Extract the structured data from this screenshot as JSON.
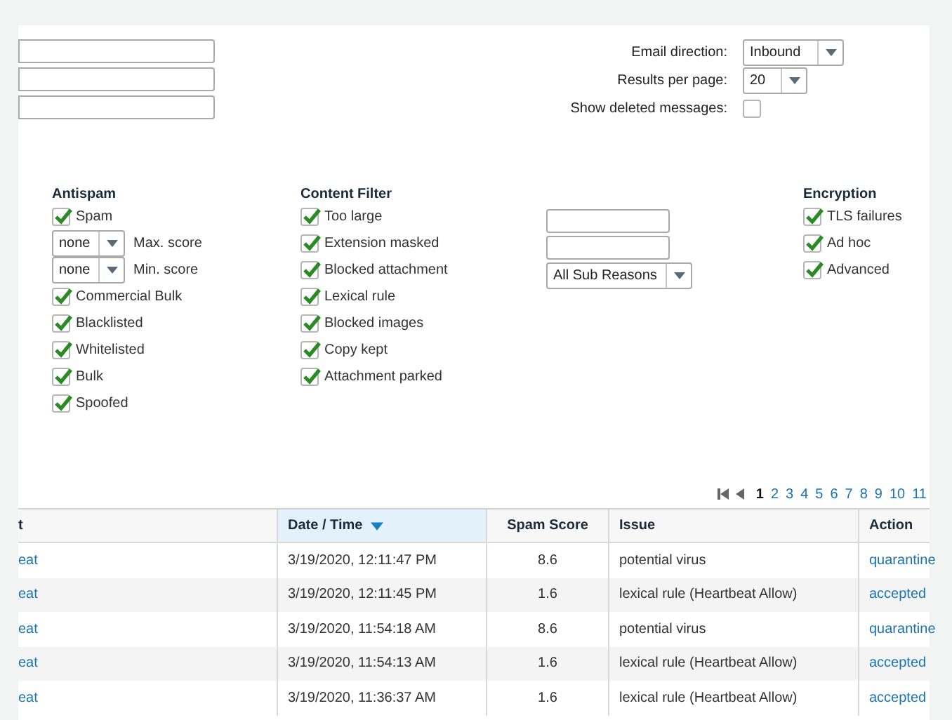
{
  "search_fields": [
    {
      "kind": "text"
    },
    {
      "kind": "text"
    },
    {
      "kind": "text"
    }
  ],
  "options": [
    {
      "kind": "select",
      "label": "Email direction:",
      "value": "Inbound"
    },
    {
      "kind": "select",
      "label": "Results per page:",
      "value": "20"
    },
    {
      "kind": "checkbox",
      "label": "Show deleted messages:",
      "checked": false
    }
  ],
  "antispam": {
    "title": "Antispam",
    "items": [
      {
        "kind": "checkbox",
        "label": "Spam",
        "checked": true
      },
      {
        "kind": "select",
        "selected_option": "none",
        "caption": "Max. score"
      },
      {
        "kind": "select",
        "selected_option": "none",
        "caption": "Min. score"
      },
      {
        "kind": "checkbox",
        "label": "Commercial Bulk",
        "checked": true
      },
      {
        "kind": "checkbox",
        "label": "Blacklisted",
        "checked": true
      },
      {
        "kind": "checkbox",
        "label": "Whitelisted",
        "checked": true
      },
      {
        "kind": "checkbox",
        "label": "Bulk",
        "checked": true
      },
      {
        "kind": "checkbox",
        "label": "Spoofed",
        "checked": true
      }
    ]
  },
  "content_filter": {
    "title": "Content Filter",
    "items": [
      {
        "label": "Too large",
        "checked": true
      },
      {
        "label": "Extension masked",
        "checked": true
      },
      {
        "label": "Blocked attachment",
        "checked": true
      },
      {
        "label": "Lexical rule",
        "checked": true
      },
      {
        "label": "Blocked images",
        "checked": true
      },
      {
        "label": "Copy kept",
        "checked": true
      },
      {
        "label": "Attachment parked",
        "checked": true
      }
    ]
  },
  "sub_filter": {
    "fields": [
      {
        "kind": "text"
      },
      {
        "kind": "text"
      }
    ],
    "select": "All Sub Reasons"
  },
  "encryption": {
    "title": "Encryption",
    "items": [
      {
        "label": "TLS failures",
        "checked": true
      },
      {
        "label": "Ad hoc",
        "checked": true
      },
      {
        "label": "Advanced",
        "checked": true
      }
    ]
  },
  "pagination": {
    "pages": [
      {
        "label": "1",
        "selected": true
      },
      {
        "label": "2",
        "selected": false
      },
      {
        "label": "3",
        "selected": false
      },
      {
        "label": "4",
        "selected": false
      },
      {
        "label": "5",
        "selected": false
      },
      {
        "label": "6",
        "selected": false
      },
      {
        "label": "7",
        "selected": false
      },
      {
        "label": "8",
        "selected": false
      },
      {
        "label": "9",
        "selected": false
      },
      {
        "label": "10",
        "selected": false
      },
      {
        "label": "11",
        "selected": false
      }
    ]
  },
  "table": {
    "columns": [
      {
        "label": "t",
        "sorted": false
      },
      {
        "label": "Date / Time",
        "sorted": true
      },
      {
        "label": "Spam Score",
        "sorted": false
      },
      {
        "label": "Issue",
        "sorted": false
      },
      {
        "label": "Action",
        "sorted": false
      }
    ],
    "rows": [
      [
        "eat",
        "3/19/2020, 12:11:47 PM",
        "8.6",
        "potential virus",
        "quarantine"
      ],
      [
        "eat",
        "3/19/2020, 12:11:45 PM",
        "1.6",
        "lexical rule (Heartbeat Allow)",
        "accepted"
      ],
      [
        "eat",
        "3/19/2020, 11:54:18 AM",
        "8.6",
        "potential virus",
        "quarantine"
      ],
      [
        "eat",
        "3/19/2020, 11:54:13 AM",
        "1.6",
        "lexical rule (Heartbeat Allow)",
        "accepted"
      ],
      [
        "eat",
        "3/19/2020, 11:36:37 AM",
        "1.6",
        "lexical rule (Heartbeat Allow)",
        "accepted"
      ]
    ]
  }
}
